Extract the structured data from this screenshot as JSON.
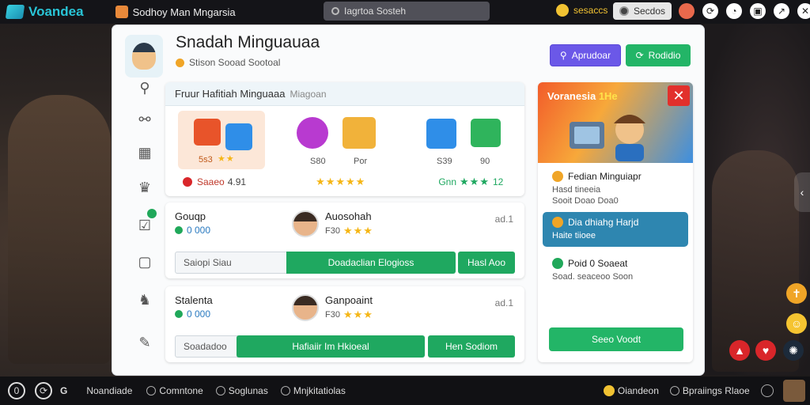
{
  "app": {
    "logo_text": "Voandea",
    "game_title": "Sodhoy Man Mngarsia"
  },
  "search": {
    "value": "Iagrtoa Sosteh"
  },
  "topbar": {
    "coins": "sesaccs",
    "status_label": "Secdos"
  },
  "header": {
    "title": "Snadah Minguauaa",
    "subtitle": "Stison Sooad Sootoal"
  },
  "actions": {
    "primary_label": "Aprudoar",
    "secondary_label": "Rodidio"
  },
  "featured": {
    "title": "Fruur Hafitiah Minguaaa",
    "title_muted": "Miagoan",
    "prizes": [
      {
        "value": "5s3"
      },
      {
        "value": "S80",
        "badge": "Por"
      },
      {
        "value": "S39",
        "badge": "90"
      }
    ],
    "footer_left": "Saaeo",
    "footer_left_count": "4.91",
    "footer_right": "Gnn",
    "footer_right_count": "12"
  },
  "cards": [
    {
      "label": "Gouqp",
      "status": "0 000",
      "player_name": "Auosohah",
      "player_meta": "F30",
      "count": "ad.1",
      "input_value": "Saiopi Siau",
      "main_button": "Doadaclian Elogioss",
      "side_button": "Hasl Aoo"
    },
    {
      "label": "Stalenta",
      "status": "0 000",
      "player_name": "Ganpoaint",
      "player_meta": "F30",
      "count": "ad.1",
      "input_value": "Soadadoo",
      "main_button": "Hafiaiir Im Hkioeal",
      "side_button": "Hen Sodiom"
    }
  ],
  "promo": {
    "title": "Voranesia",
    "title_accent": "1He",
    "options": [
      {
        "title": "Fedian Minguiapr",
        "sub": "Hasd tineeia",
        "sub2": "Sooit Doao Doa0"
      },
      {
        "title": "Dia dhiahg Harjd",
        "sub": "Haite tiioee"
      },
      {
        "title": "Poid 0 Soaeat",
        "sub": "Soad. seaceoo Soon"
      }
    ],
    "cta": "Seeo Voodt"
  },
  "bottombar": {
    "brand": "Noandiade",
    "items": [
      "Comntone",
      "Soglunas",
      "Mnjkitatiolas"
    ],
    "right_coins": "Oiandeon",
    "right_label": "Bpraiings Rlaoe"
  },
  "colors": {
    "accent": "#6b58e8",
    "success": "#23b567",
    "danger": "#e2302c",
    "topbar": "#141418"
  }
}
